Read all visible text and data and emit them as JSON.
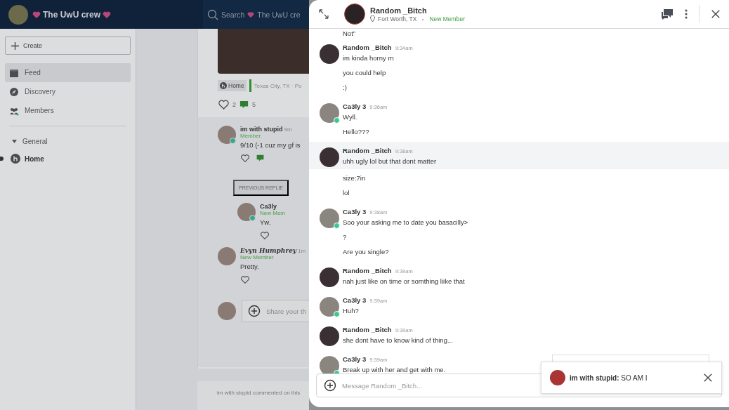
{
  "community": {
    "name": "The UwU crew",
    "search_placeholder": "Search",
    "search_scope": "The UwU cre"
  },
  "sidebar": {
    "create_label": "Create",
    "items": [
      {
        "label": "Feed",
        "selected": true,
        "kind": "feed"
      },
      {
        "label": "Discovery",
        "selected": false,
        "kind": "compass"
      },
      {
        "label": "Members",
        "selected": false,
        "kind": "members"
      }
    ],
    "section": {
      "label": "General",
      "expanded": true,
      "items": [
        {
          "label": "Home",
          "selected": true
        }
      ]
    }
  },
  "post": {
    "tag": "Home",
    "location": "Texas City, TX · Po",
    "likes": "2",
    "comments_count": "5",
    "comments": [
      {
        "author": "im with stupid",
        "time": "9m",
        "role": "Member",
        "online": true,
        "text": "9/10 (-1 cuz my gf is",
        "previous_replies": "PREVIOUS REPLIE",
        "replies": [
          {
            "author": "Ca3ly",
            "role": "New Mem",
            "online": true,
            "text": "Yw."
          }
        ]
      },
      {
        "author": "Evyn Humphrey",
        "time": "1m",
        "role": "New Member",
        "online": false,
        "text": "Pretty."
      }
    ],
    "share_placeholder": "Share your th"
  },
  "next_card": {
    "text": "im with stupid commented on this"
  },
  "chat": {
    "title": "Random _Bitch",
    "location": "Fort Worth, TX",
    "badge": "New Member",
    "continued_lines": [
      "Not”"
    ],
    "messages": [
      {
        "author": "Random _Bitch",
        "time": "9:34am",
        "online": false,
        "highlighted": false,
        "lines": [
          "im kinda horny rn",
          "you could help",
          ":)"
        ]
      },
      {
        "author": "Ca3ly 3",
        "time": "9:36am",
        "online": true,
        "highlighted": false,
        "lines": [
          "Wyll.",
          "Hello???"
        ]
      },
      {
        "author": "Random _Bitch",
        "time": "9:38am",
        "online": false,
        "highlighted": true,
        "lines": [
          "uhh ugly lol but that dont matter",
          "size:7in",
          "lol"
        ]
      },
      {
        "author": "Ca3ly 3",
        "time": "9:38am",
        "online": true,
        "highlighted": false,
        "lines": [
          "Soo your asking me to date you basacilly>",
          "?",
          "Are you single?"
        ]
      },
      {
        "author": "Random _Bitch",
        "time": "9:39am",
        "online": false,
        "highlighted": false,
        "lines": [
          "nah just like on time or somthing liike that"
        ]
      },
      {
        "author": "Ca3ly 3",
        "time": "9:39am",
        "online": true,
        "highlighted": false,
        "lines": [
          "Huh?"
        ]
      },
      {
        "author": "Random _Bitch",
        "time": "9:39am",
        "online": false,
        "highlighted": false,
        "lines": [
          "she dont have to know kind of thing..."
        ]
      },
      {
        "author": "Ca3ly 3",
        "time": "9:39am",
        "online": true,
        "highlighted": false,
        "lines": [
          "Break up with her and get with me."
        ]
      }
    ],
    "composer_placeholder": "Message Random _Bitch...",
    "toast": {
      "author": "im with stupid:",
      "text": "SO AM I"
    }
  }
}
